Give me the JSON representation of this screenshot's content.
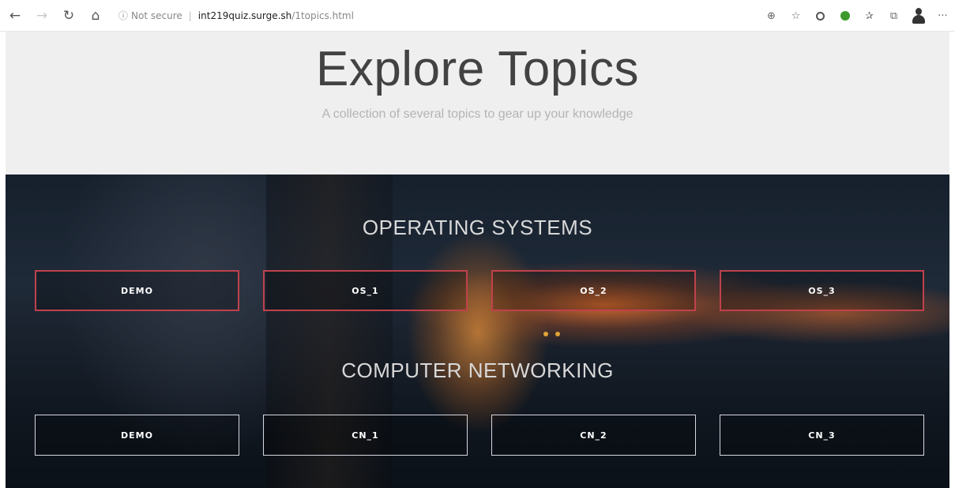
{
  "browser": {
    "back_icon": "←",
    "forward_icon": "→",
    "refresh_icon": "↻",
    "home_icon": "⌂",
    "info_icon": "ⓘ",
    "security_label": "Not secure",
    "separator": "|",
    "url_host": "int219quiz.surge.sh",
    "url_path": "/1topics.html",
    "zoom_icon": "⊕",
    "favorite_icon": "☆",
    "favorites_bar_icon": "✰",
    "collections_icon": "⧉",
    "more_icon": "···"
  },
  "header": {
    "title": "Explore Topics",
    "subtitle": "A collection of several topics to gear up your knowledge"
  },
  "sections": [
    {
      "title": "OPERATING SYSTEMS",
      "buttons": [
        "DEMO",
        "OS_1",
        "OS_2",
        "OS_3"
      ]
    },
    {
      "title": "COMPUTER NETWORKING",
      "buttons": [
        "DEMO",
        "CN_1",
        "CN_2",
        "CN_3"
      ]
    }
  ],
  "colors": {
    "os_border": "#c0414c",
    "cn_border": "#d7d7e2",
    "header_bg": "#efefef"
  }
}
